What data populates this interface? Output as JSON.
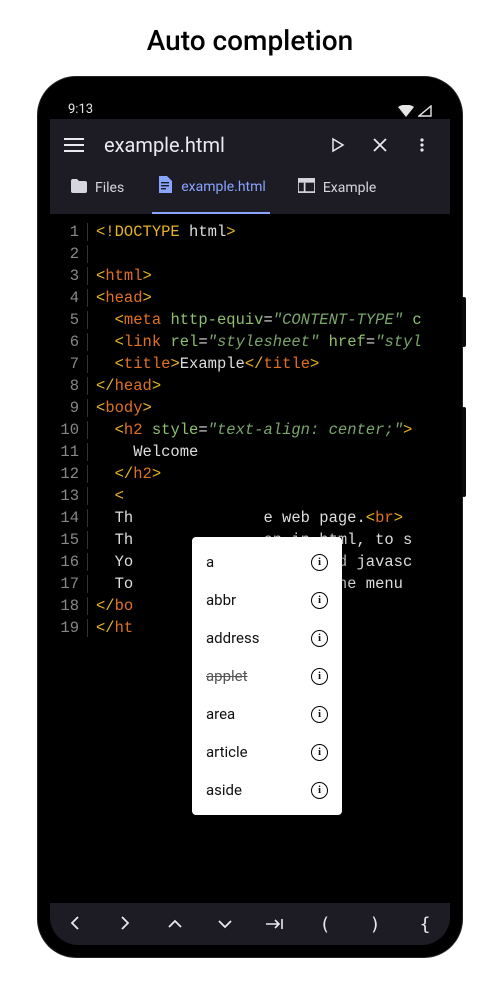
{
  "page_heading": "Auto completion",
  "status": {
    "time": "9:13"
  },
  "appbar": {
    "title": "example.html",
    "actions": {
      "run": "Run",
      "close": "Close",
      "more": "More"
    }
  },
  "tabs": [
    {
      "id": "files",
      "label": "Files",
      "icon": "folder-icon",
      "active": false
    },
    {
      "id": "example",
      "label": "example.html",
      "icon": "file-icon",
      "active": true
    },
    {
      "id": "preview",
      "label": "Example",
      "icon": "preview-icon",
      "active": false
    }
  ],
  "code_lines": [
    {
      "n": 1,
      "segments": [
        [
          "<!",
          "brack"
        ],
        [
          "DOCTYPE",
          "doctype-kw"
        ],
        [
          " html",
          "meta"
        ],
        [
          ">",
          "brack"
        ]
      ]
    },
    {
      "n": 2,
      "segments": []
    },
    {
      "n": 3,
      "segments": [
        [
          "<",
          "brack"
        ],
        [
          "html",
          "tag"
        ],
        [
          ">",
          "brack"
        ]
      ]
    },
    {
      "n": 4,
      "segments": [
        [
          "<",
          "brack"
        ],
        [
          "head",
          "tag"
        ],
        [
          ">",
          "brack"
        ]
      ]
    },
    {
      "n": 5,
      "segments": [
        [
          "  ",
          ""
        ],
        [
          "<",
          "brack"
        ],
        [
          "meta",
          "tag"
        ],
        [
          " ",
          ""
        ],
        [
          "http-equiv",
          "attr"
        ],
        [
          "=",
          "punc"
        ],
        [
          "\"CONTENT-TYPE\"",
          "str"
        ],
        [
          " c",
          "attr"
        ]
      ]
    },
    {
      "n": 6,
      "segments": [
        [
          "  ",
          ""
        ],
        [
          "<",
          "brack"
        ],
        [
          "link",
          "tag"
        ],
        [
          " ",
          ""
        ],
        [
          "rel",
          "attr"
        ],
        [
          "=",
          "punc"
        ],
        [
          "\"stylesheet\"",
          "str"
        ],
        [
          " ",
          ""
        ],
        [
          "href",
          "attr"
        ],
        [
          "=",
          "punc"
        ],
        [
          "\"styl",
          "str"
        ]
      ]
    },
    {
      "n": 7,
      "segments": [
        [
          "  ",
          ""
        ],
        [
          "<",
          "brack"
        ],
        [
          "title",
          "tag"
        ],
        [
          ">",
          "brack"
        ],
        [
          "Example",
          "text"
        ],
        [
          "</",
          "brack"
        ],
        [
          "title",
          "tag"
        ],
        [
          ">",
          "brack"
        ]
      ]
    },
    {
      "n": 8,
      "segments": [
        [
          "</",
          "brack"
        ],
        [
          "head",
          "tag"
        ],
        [
          ">",
          "brack"
        ]
      ]
    },
    {
      "n": 9,
      "segments": [
        [
          "<",
          "brack"
        ],
        [
          "body",
          "tag"
        ],
        [
          ">",
          "brack"
        ]
      ]
    },
    {
      "n": 10,
      "segments": [
        [
          "  ",
          ""
        ],
        [
          "<",
          "brack"
        ],
        [
          "h2",
          "tag"
        ],
        [
          " ",
          ""
        ],
        [
          "style",
          "attr"
        ],
        [
          "=",
          "punc"
        ],
        [
          "\"text-align: center;\"",
          "str"
        ],
        [
          ">",
          "brack"
        ]
      ]
    },
    {
      "n": 11,
      "segments": [
        [
          "    Welcome",
          "text"
        ]
      ]
    },
    {
      "n": 12,
      "segments": [
        [
          "  ",
          ""
        ],
        [
          "</",
          "brack"
        ],
        [
          "h2",
          "tag"
        ],
        [
          ">",
          "brack"
        ]
      ]
    },
    {
      "n": 13,
      "segments": [
        [
          "  ",
          ""
        ],
        [
          "<",
          "brack"
        ]
      ]
    },
    {
      "n": 14,
      "segments": [
        [
          "  Th",
          "text"
        ],
        [
          "              ",
          "text"
        ],
        [
          "e web page.",
          "text"
        ],
        [
          "<",
          "brack"
        ],
        [
          "br",
          "tag"
        ],
        [
          ">",
          "brack"
        ]
      ]
    },
    {
      "n": 15,
      "segments": [
        [
          "  Th",
          "text"
        ],
        [
          "              ",
          "text"
        ],
        [
          "en in html, to s",
          "text"
        ]
      ]
    },
    {
      "n": 16,
      "segments": [
        [
          "  Yo",
          "text"
        ],
        [
          "              ",
          "text"
        ],
        [
          ", css and javasc",
          "text"
        ]
      ]
    },
    {
      "n": 17,
      "segments": [
        [
          "  To",
          "text"
        ],
        [
          "              ",
          "text"
        ],
        [
          "es use the menu ",
          "text"
        ]
      ]
    },
    {
      "n": 18,
      "segments": [
        [
          "</",
          "brack"
        ],
        [
          "bo",
          "tag"
        ]
      ]
    },
    {
      "n": 19,
      "segments": [
        [
          "</",
          "brack"
        ],
        [
          "ht",
          "tag"
        ]
      ]
    }
  ],
  "autocomplete": {
    "items": [
      {
        "label": "a",
        "deprecated": false
      },
      {
        "label": "abbr",
        "deprecated": false
      },
      {
        "label": "address",
        "deprecated": false
      },
      {
        "label": "applet",
        "deprecated": true
      },
      {
        "label": "area",
        "deprecated": false
      },
      {
        "label": "article",
        "deprecated": false
      },
      {
        "label": "aside",
        "deprecated": false
      }
    ]
  },
  "bottom_keys": [
    "‹",
    "›",
    "˄",
    "˅",
    "⇥",
    "(",
    ")",
    "{"
  ]
}
